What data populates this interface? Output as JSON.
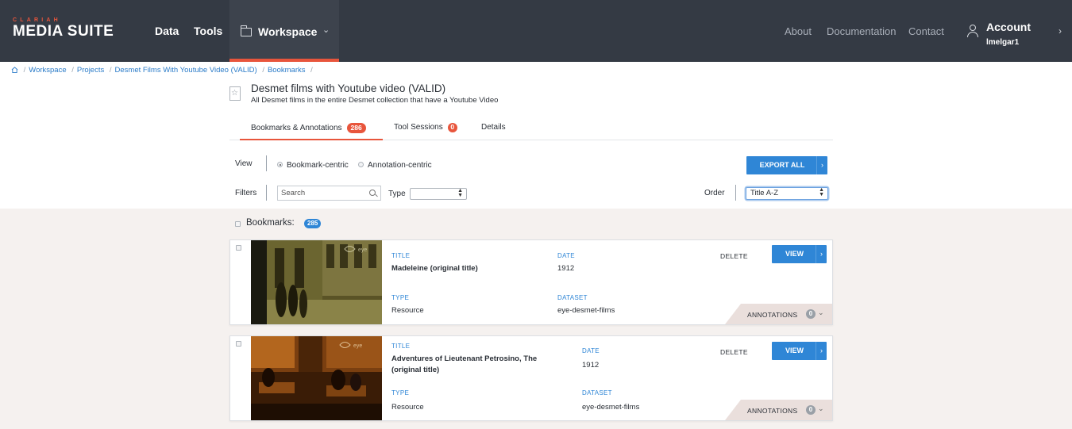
{
  "nav": {
    "brand_small": "CLARIAH",
    "brand_main": "MEDIA SUITE",
    "links": [
      "Data",
      "Tools"
    ],
    "workspace": "Workspace",
    "right_links": [
      "About",
      "Documentation",
      "Contact"
    ],
    "account_label": "Account",
    "account_user": "lmelgar1"
  },
  "breadcrumb": [
    "Workspace",
    "Projects",
    "Desmet Films With Youtube Video (VALID)",
    "Bookmarks"
  ],
  "project": {
    "title": "Desmet films with Youtube video (VALID)",
    "description": "All Desmet films in the entire Desmet collection that have a Youtube Video"
  },
  "tabs": [
    {
      "label": "Bookmarks & Annotations",
      "count": "286"
    },
    {
      "label": "Tool Sessions",
      "count": "0"
    },
    {
      "label": "Details",
      "count": ""
    }
  ],
  "controls": {
    "view_label": "View",
    "view_options": [
      "Bookmark-centric",
      "Annotation-centric"
    ],
    "view_selected": "Bookmark-centric",
    "export_label": "EXPORT ALL",
    "filters_label": "Filters",
    "search_placeholder": "Search",
    "type_label": "Type",
    "type_value": "",
    "order_label": "Order",
    "order_value": "Title A-Z"
  },
  "bookmarks": {
    "heading": "Bookmarks",
    "colon": ":",
    "count": "285",
    "field_labels": {
      "title": "TITLE",
      "date": "DATE",
      "type": "TYPE",
      "dataset": "DATASET"
    },
    "delete_label": "DELETE",
    "view_label": "VIEW",
    "annotations_label": "ANNOTATIONS",
    "items": [
      {
        "title": "Madeleine (original title)",
        "date": "1912",
        "type": "Resource",
        "dataset": "eye-desmet-films",
        "annotations": "0"
      },
      {
        "title": "Adventures of Lieutenant Petrosino, The (original title)",
        "date": "1912",
        "type": "Resource",
        "dataset": "eye-desmet-films",
        "annotations": "0"
      }
    ]
  },
  "colors": {
    "nav_bg": "#343a44",
    "accent": "#e8553c",
    "primary": "#2f86d6",
    "area_bg": "#f5f1ef"
  }
}
